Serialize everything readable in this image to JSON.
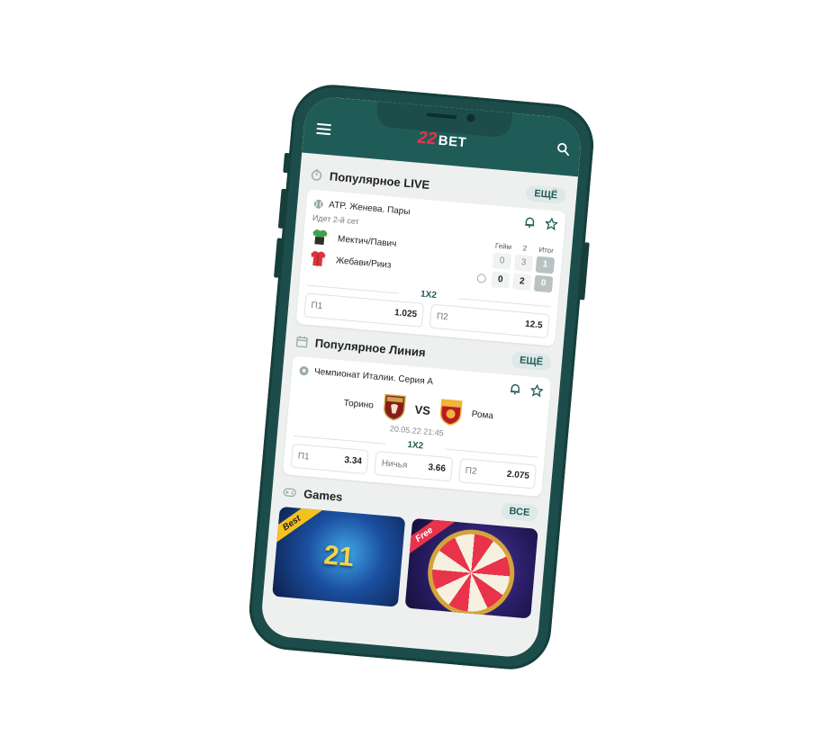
{
  "app": {
    "logo_number": "22",
    "logo_word": "BET"
  },
  "live_section": {
    "title": "Популярное LIVE",
    "more_label": "ЕЩЁ",
    "card": {
      "league": "ATP. Женева. Пары",
      "status": "Идет 2-й сет",
      "team1": "Мектич/Павич",
      "team2": "Жебави/Рииз",
      "score_headers": [
        "Гейм",
        "2",
        "Итог"
      ],
      "team1_scores": [
        "0",
        "3",
        "1"
      ],
      "team2_scores": [
        "0",
        "2",
        "0"
      ],
      "market": "1X2",
      "odds": [
        {
          "name": "П1",
          "value": "1.025"
        },
        {
          "name": "П2",
          "value": "12.5"
        }
      ]
    }
  },
  "line_section": {
    "title": "Популярное Линия",
    "more_label": "ЕЩЁ",
    "card": {
      "league": "Чемпионат Италии. Серия А",
      "home": "Торино",
      "away": "Рома",
      "vs": "VS",
      "datetime": "20.05.22 21:45",
      "market": "1X2",
      "odds": [
        {
          "name": "П1",
          "value": "3.34"
        },
        {
          "name": "Ничья",
          "value": "3.66"
        },
        {
          "name": "П2",
          "value": "2.075"
        }
      ]
    }
  },
  "games_section": {
    "title": "Games",
    "more_label": "ВСЕ",
    "items": [
      {
        "ribbon": "Best",
        "art": "21"
      },
      {
        "ribbon": "Free",
        "art": ""
      }
    ]
  },
  "colors": {
    "phone_body": "#1c4d4a",
    "header": "#1f5c57",
    "accent": "#1f5c57",
    "logo_red": "#e8334a"
  }
}
